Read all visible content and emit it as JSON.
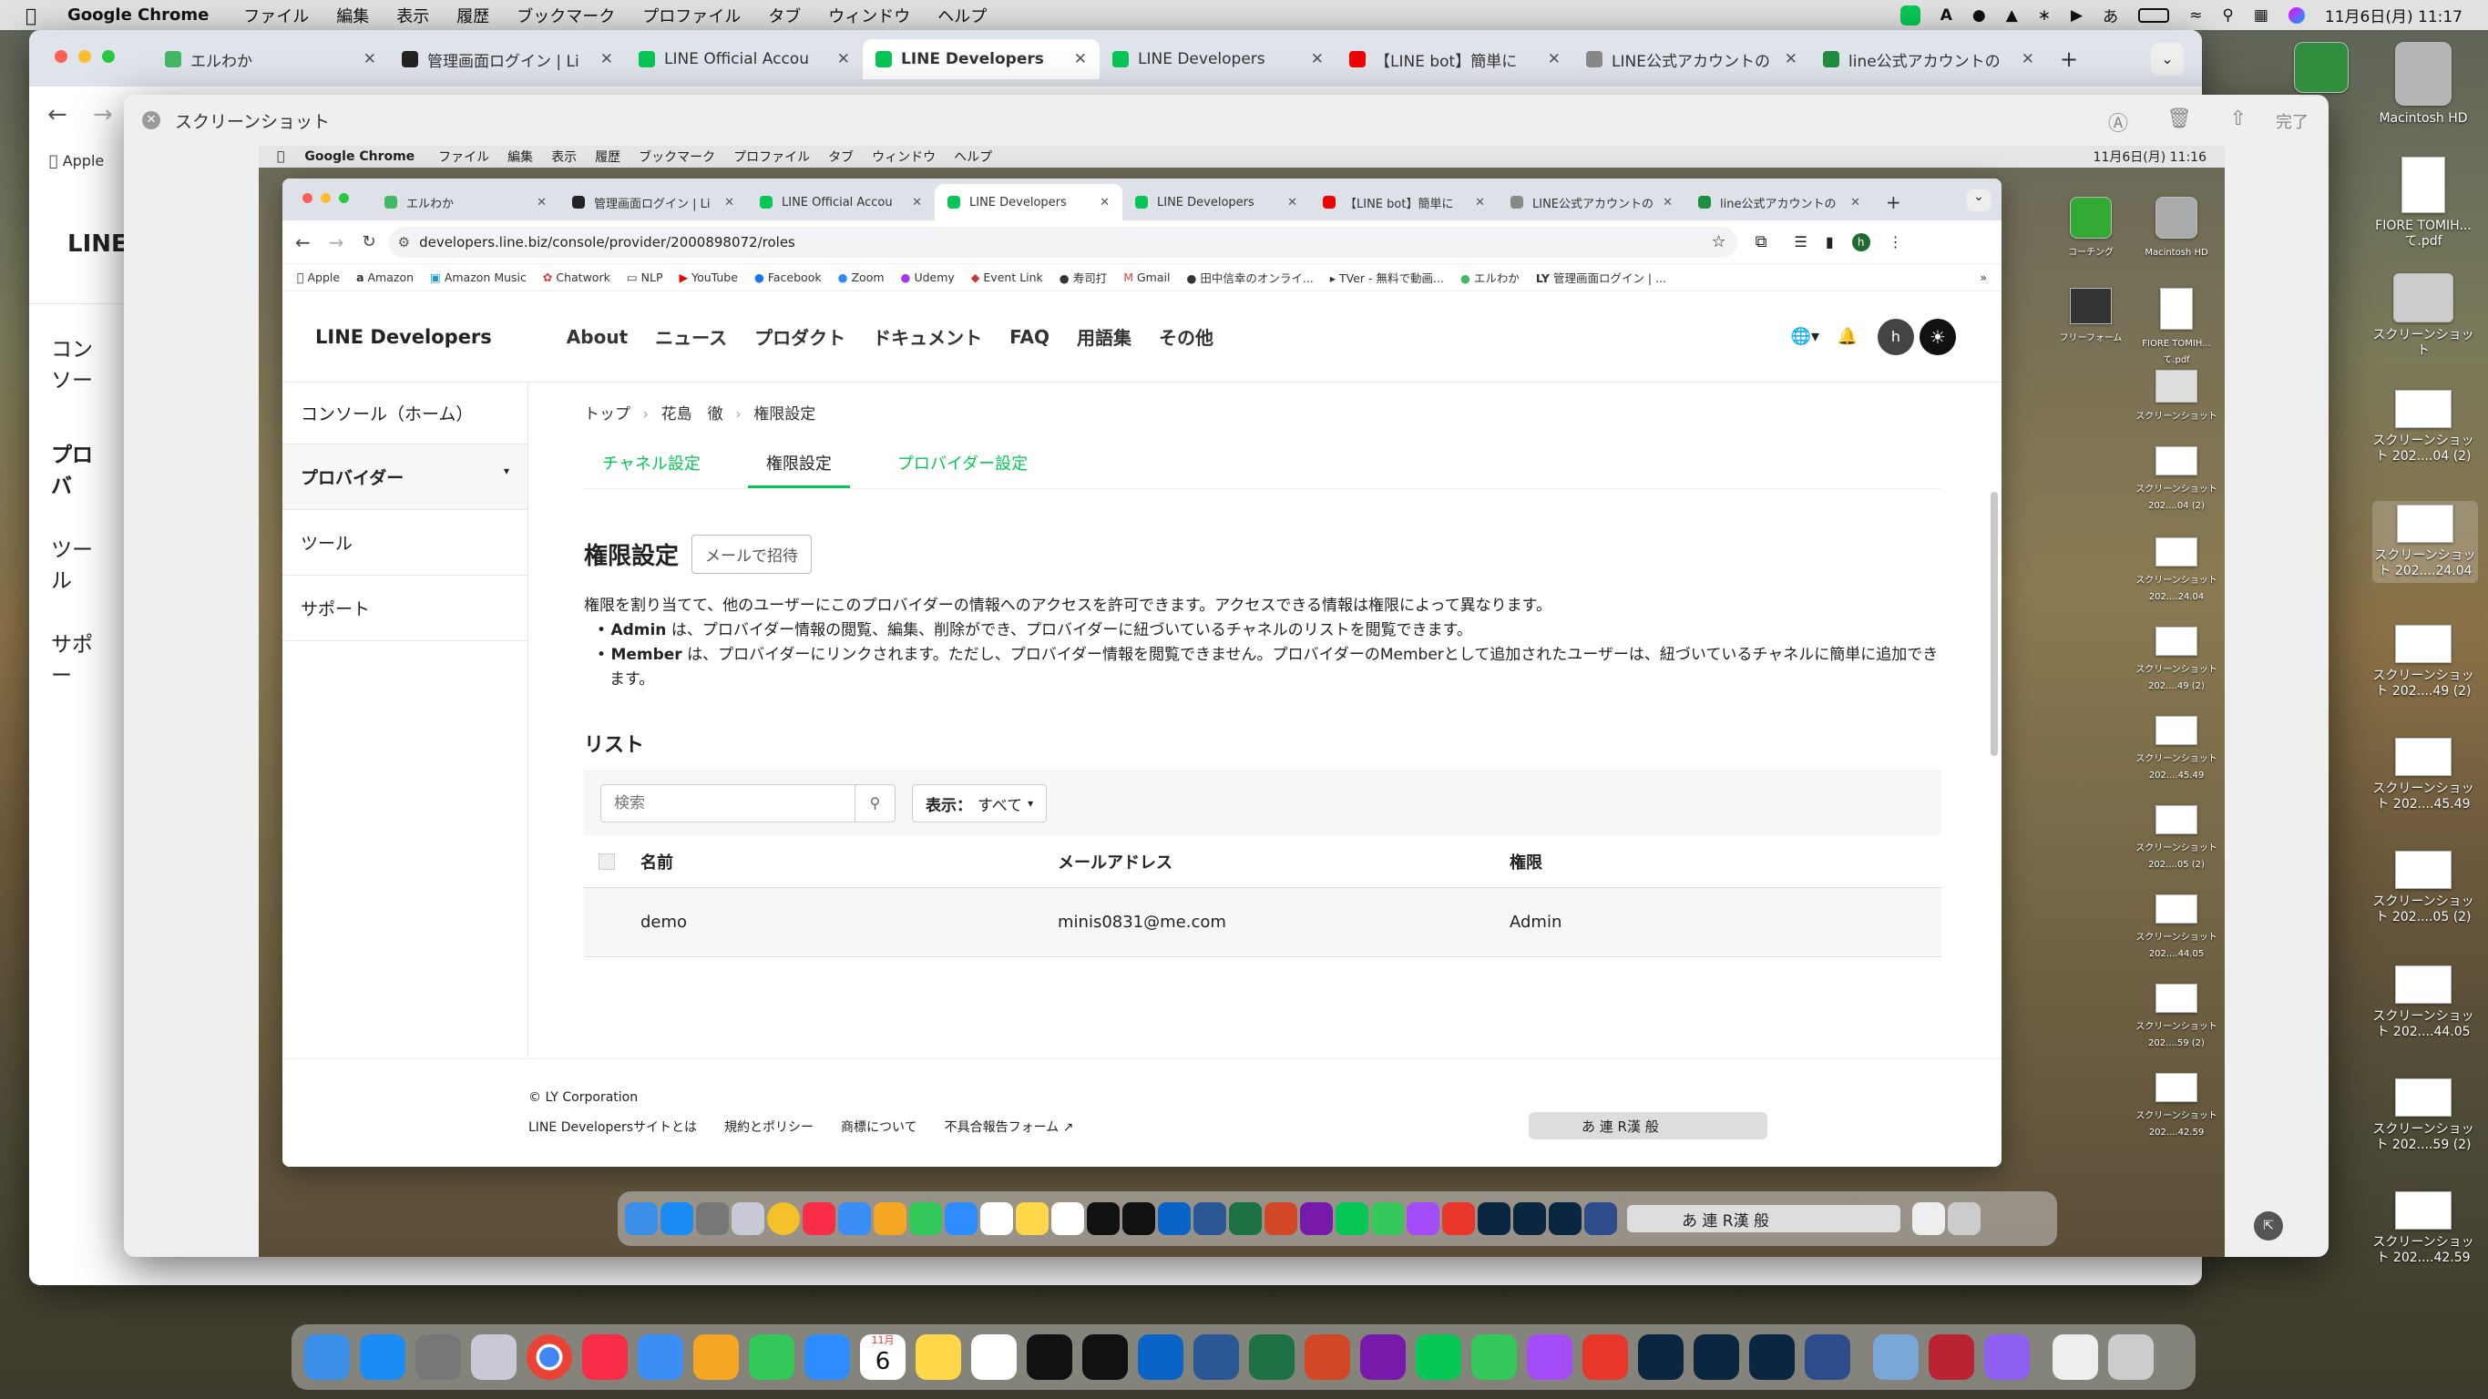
{
  "menubar": {
    "app": "Google Chrome",
    "items": [
      "ファイル",
      "編集",
      "表示",
      "履歴",
      "ブックマーク",
      "プロファイル",
      "タブ",
      "ウィンドウ",
      "ヘルプ"
    ],
    "clock": "11月6日(月) 11:17"
  },
  "back_window": {
    "tabs": [
      {
        "label": "エルわか",
        "color": "#44b764"
      },
      {
        "label": "管理画面ログイン | Li",
        "color": "#222"
      },
      {
        "label": "LINE Official Accou",
        "color": "#06c755"
      },
      {
        "label": "LINE Developers",
        "color": "#06c755"
      },
      {
        "label": "LINE Developers",
        "color": "#06c755"
      },
      {
        "label": "【LINE bot】簡単に",
        "color": "#e00"
      },
      {
        "label": "LINE公式アカウントの",
        "color": "#888"
      },
      {
        "label": "line公式アカウントの",
        "color": "#1e8e3e"
      }
    ],
    "active_tab": 3,
    "bookmark_apple": "Apple",
    "logo": "LINE",
    "sidebar": [
      "コンソー",
      "プロバ",
      "ツール",
      "サポー"
    ]
  },
  "preview": {
    "title": "スクリーンショット",
    "done": "完了"
  },
  "inner_menubar": {
    "app": "Google Chrome",
    "items": [
      "ファイル",
      "編集",
      "表示",
      "履歴",
      "ブックマーク",
      "プロファイル",
      "タブ",
      "ウィンドウ",
      "ヘルプ"
    ],
    "clock": "11月6日(月) 11:16"
  },
  "inner_tabs": [
    {
      "label": "エルわか",
      "color": "#44b764"
    },
    {
      "label": "管理画面ログイン | Li",
      "color": "#222"
    },
    {
      "label": "LINE Official Accou",
      "color": "#06c755"
    },
    {
      "label": "LINE Developers",
      "color": "#06c755"
    },
    {
      "label": "LINE Developers",
      "color": "#06c755"
    },
    {
      "label": "【LINE bot】簡単に",
      "color": "#e00"
    },
    {
      "label": "LINE公式アカウントの",
      "color": "#888"
    },
    {
      "label": "line公式アカウントの",
      "color": "#1e8e3e"
    }
  ],
  "url": "developers.line.biz/console/provider/2000898072/roles",
  "bookmarks": [
    "Apple",
    "Amazon",
    "Amazon Music",
    "Chatwork",
    "NLP",
    "YouTube",
    "Facebook",
    "Zoom",
    "Udemy",
    "Event Link",
    "寿司打",
    "Gmail",
    "田中信幸のオンライ...",
    "TVer - 無料で動画...",
    "エルわか",
    "管理画面ログイン | ..."
  ],
  "site": {
    "logo": "LINE Developers",
    "nav": [
      "About",
      "ニュース",
      "プロダクト",
      "ドキュメント",
      "FAQ",
      "用語集",
      "その他"
    ],
    "avatar_initial": "h"
  },
  "sidebar": {
    "home": "コンソール（ホーム）",
    "provider": "プロバイダー",
    "tools": "ツール",
    "support": "サポート"
  },
  "breadcrumb": [
    "トップ",
    "花島　徹",
    "権限設定"
  ],
  "subtabs": [
    "チャネル設定",
    "権限設定",
    "プロバイダー設定"
  ],
  "page": {
    "title": "権限設定",
    "invite": "メールで招待",
    "desc": "権限を割り当てて、他のユーザーにこのプロバイダーの情報へのアクセスを許可できます。アクセスできる情報は権限によって異なります。",
    "admin_label": "Admin",
    "admin_text": " は、プロバイダー情報の閲覧、編集、削除ができ、プロバイダーに紐づいているチャネルのリストを閲覧できます。",
    "member_label": "Member",
    "member_text": " は、プロバイダーにリンクされます。ただし、プロバイダー情報を閲覧できません。プロバイダーのMemberとして追加されたユーザーは、紐づいているチャネルに簡単に追加できます。"
  },
  "list": {
    "title": "リスト",
    "search_placeholder": "検索",
    "filter_label": "表示：",
    "filter_value": "すべて",
    "headers": [
      "名前",
      "メールアドレス",
      "権限"
    ],
    "rows": [
      {
        "name": "demo",
        "email": "minis0831@me.com",
        "role": "Admin"
      }
    ]
  },
  "footer": {
    "copyright": "© LY Corporation",
    "links": [
      "LINE Developersサイトとは",
      "規約とポリシー",
      "商標について",
      "不具合報告フォーム"
    ]
  },
  "ime": {
    "text": "あ 連 R漢 般"
  },
  "desktop": {
    "outer": [
      {
        "label": "Macintosh HD"
      },
      {
        "label": "FIORE TOMIH...て.pdf"
      },
      {
        "label": "スクリーンショット"
      },
      {
        "label": "スクリーンショット 202....04 (2)"
      },
      {
        "label": "スクリーンショット 202....24.04"
      },
      {
        "label": "スクリーンショット 202....49 (2)"
      },
      {
        "label": "スクリーンショット 202....45.49"
      },
      {
        "label": "スクリーンショット 202....05 (2)"
      },
      {
        "label": "スクリーンショット 202....44.05"
      },
      {
        "label": "スクリーンショット 202....59 (2)"
      },
      {
        "label": "スクリーンショット 202....42.59"
      }
    ],
    "inner": [
      {
        "label": "コーチング"
      },
      {
        "label": "Macintosh HD"
      },
      {
        "label": "フリーフォーム"
      },
      {
        "label": "FIORE TOMIH...て.pdf"
      },
      {
        "label": "スクリーンショット"
      },
      {
        "label": "スクリーンショット 202....04 (2)"
      },
      {
        "label": "スクリーンショット 202....24.04"
      },
      {
        "label": "スクリーンショット 202....49 (2)"
      },
      {
        "label": "スクリーンショット 202....45.49"
      },
      {
        "label": "スクリーンショット 202....05 (2)"
      },
      {
        "label": "スクリーンショット 202....44.05"
      },
      {
        "label": "スクリーンショット 202....59 (2)"
      },
      {
        "label": "スクリーンショット 202....42.59"
      }
    ]
  },
  "dock": {
    "calendar_month": "11月",
    "calendar_day": "6",
    "apps": [
      {
        "name": "finder",
        "color": "#3b8fe6"
      },
      {
        "name": "app-store",
        "color": "#1c8cf5"
      },
      {
        "name": "settings",
        "color": "#777"
      },
      {
        "name": "launchpad",
        "color": "#c9c9d6"
      },
      {
        "name": "chrome",
        "color": "#f3c12a"
      },
      {
        "name": "music",
        "color": "#fa2d48"
      },
      {
        "name": "mail",
        "color": "#3c8ef7"
      },
      {
        "name": "photos",
        "color": "#f5a623"
      },
      {
        "name": "facetime",
        "color": "#34c759"
      },
      {
        "name": "zoom",
        "color": "#2d8cff"
      },
      {
        "name": "calendar",
        "color": "#ffffff"
      },
      {
        "name": "notes",
        "color": "#ffd84a"
      },
      {
        "name": "reminders",
        "color": "#ffffff"
      },
      {
        "name": "apple-tv",
        "color": "#111"
      },
      {
        "name": "kindle",
        "color": "#111"
      },
      {
        "name": "outlook",
        "color": "#0a64c8"
      },
      {
        "name": "word",
        "color": "#2b5797"
      },
      {
        "name": "excel",
        "color": "#1e7145"
      },
      {
        "name": "powerpoint",
        "color": "#d24726"
      },
      {
        "name": "onenote",
        "color": "#7719aa"
      },
      {
        "name": "line",
        "color": "#06c755"
      },
      {
        "name": "messages",
        "color": "#34c759"
      },
      {
        "name": "messenger",
        "color": "#a34cf7"
      },
      {
        "name": "creative-cloud",
        "color": "#e8362b"
      },
      {
        "name": "photoshop",
        "color": "#0b2640"
      },
      {
        "name": "lightroom-classic",
        "color": "#0b2640"
      },
      {
        "name": "lightroom",
        "color": "#0b2640"
      },
      {
        "name": "ime",
        "color": "#2d4c8c"
      },
      {
        "name": "preview",
        "color": "#7aa6d8"
      },
      {
        "name": "kotoeri",
        "color": "#b23"
      },
      {
        "name": "screen-time",
        "color": "#8e5ff0"
      },
      {
        "name": "doc",
        "color": "#eee"
      },
      {
        "name": "trash",
        "color": "#ccc"
      }
    ]
  }
}
